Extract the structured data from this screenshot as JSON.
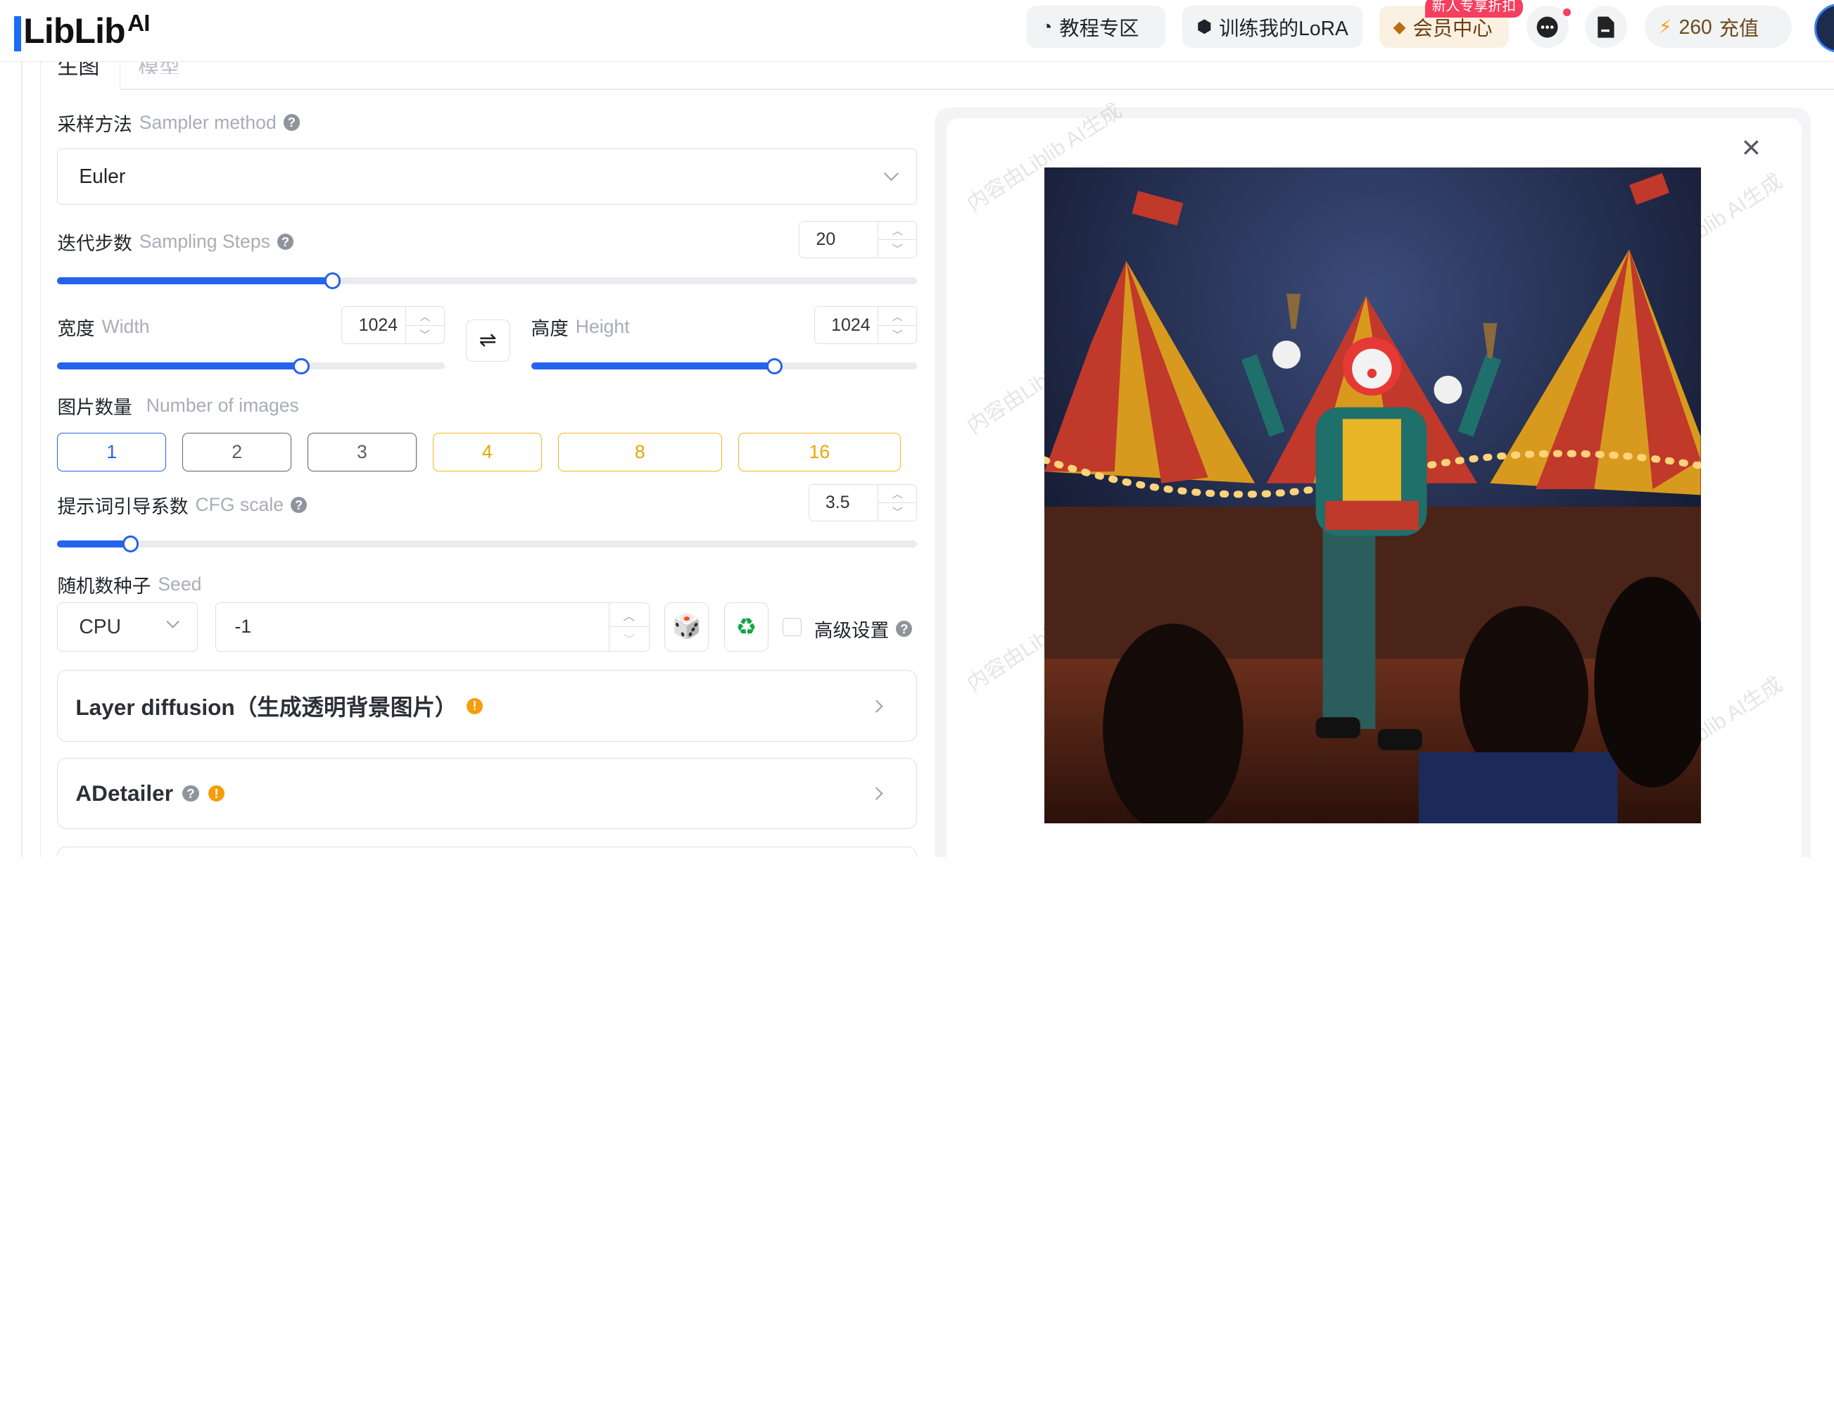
{
  "header": {
    "logo_text": "LibLib",
    "logo_ai": "AI",
    "tutorial_label": "教程专区",
    "train_lora_label": "训练我的LoRA",
    "vip_label": "会员中心",
    "vip_badge": "新人专享折扣",
    "credits": "260",
    "recharge_label": "充值"
  },
  "tabs": {
    "active": "生图",
    "other": "模型"
  },
  "sampler": {
    "label_cn": "采样方法",
    "label_en": "Sampler method",
    "value": "Euler"
  },
  "steps": {
    "label_cn": "迭代步数",
    "label_en": "Sampling Steps",
    "value": "20",
    "fraction": 0.32
  },
  "width": {
    "label_cn": "宽度",
    "label_en": "Width",
    "value": "1024",
    "fraction": 0.63
  },
  "height": {
    "label_cn": "高度",
    "label_en": "Height",
    "value": "1024",
    "fraction": 0.63
  },
  "num_images": {
    "label_cn": "图片数量",
    "label_en": "Number of images",
    "options": [
      "1",
      "2",
      "3",
      "4",
      "8",
      "16"
    ],
    "selected": "1"
  },
  "cfg": {
    "label_cn": "提示词引导系数",
    "label_en": "CFG scale",
    "value": "3.5",
    "fraction": 0.085
  },
  "seed": {
    "label_cn": "随机数种子",
    "label_en": "Seed",
    "device": "CPU",
    "value": "-1",
    "advanced_label": "高级设置"
  },
  "cards": {
    "layer_diffusion": "Layer diffusion（生成透明背景图片）",
    "adetailer": "ADetailer"
  },
  "preview": {
    "watermark": "内容由Liblib AI生成",
    "close_icon": "close-icon"
  },
  "colors": {
    "accent": "#2463eb",
    "gold": "#f2b81c"
  }
}
